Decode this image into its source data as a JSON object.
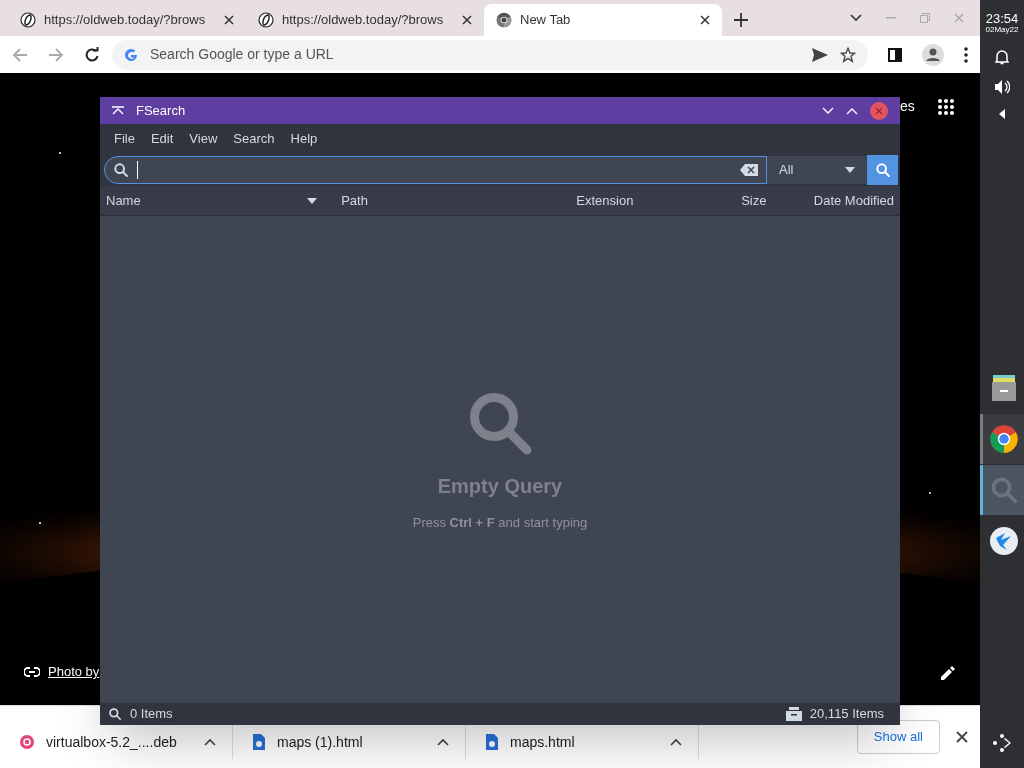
{
  "browser": {
    "tabs": [
      {
        "title": "https://oldweb.today/?brows",
        "kind": "oldweb",
        "selected": false
      },
      {
        "title": "https://oldweb.today/?brows",
        "kind": "oldweb",
        "selected": false
      },
      {
        "title": "New Tab",
        "kind": "chrome",
        "selected": true
      }
    ],
    "address": {
      "placeholder": "Search Google or type a URL"
    },
    "page": {
      "apps_label": "es",
      "photo_credit": "Photo by"
    }
  },
  "fsearch": {
    "title": "FSearch",
    "menu": [
      "File",
      "Edit",
      "View",
      "Search",
      "Help"
    ],
    "filter": "All",
    "columns": [
      {
        "label": "Name",
        "sorted": true
      },
      {
        "label": "Path",
        "sorted": false
      },
      {
        "label": "Extension",
        "sorted": false
      },
      {
        "label": "Size",
        "sorted": false
      },
      {
        "label": "Date Modified",
        "sorted": false
      }
    ],
    "empty_title": "Empty Query",
    "empty_hint": "Press **Ctrl + F** and start typing",
    "status_left": "0 Items",
    "status_right": "20,115 Items"
  },
  "downloads": {
    "items": [
      {
        "name": "virtualbox-5.2_....deb",
        "kind": "debian"
      },
      {
        "name": "maps (1).html",
        "kind": "html"
      },
      {
        "name": "maps.html",
        "kind": "html"
      }
    ],
    "show_all": "Show all"
  },
  "shelf": {
    "time": "23:54",
    "date": "02May22",
    "apps": [
      {
        "kind": "files",
        "running": false,
        "selected": false
      },
      {
        "kind": "chrome",
        "running": true,
        "selected": false
      },
      {
        "kind": "fsearch",
        "running": true,
        "selected": true
      },
      {
        "kind": "bird",
        "running": false,
        "selected": false
      }
    ]
  }
}
